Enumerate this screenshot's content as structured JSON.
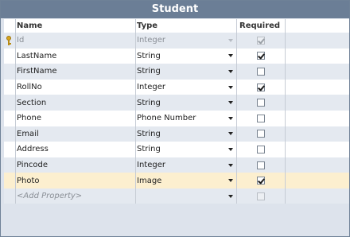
{
  "title": "Student",
  "columns": {
    "name": "Name",
    "type": "Type",
    "required": "Required"
  },
  "rows": [
    {
      "name": "Id",
      "type": "Integer",
      "required": true,
      "key": true,
      "disabled": true
    },
    {
      "name": "LastName",
      "type": "String",
      "required": true
    },
    {
      "name": "FirstName",
      "type": "String",
      "required": false
    },
    {
      "name": "RollNo",
      "type": "Integer",
      "required": true
    },
    {
      "name": "Section",
      "type": "String",
      "required": false
    },
    {
      "name": "Phone",
      "type": "Phone Number",
      "required": false
    },
    {
      "name": "Email",
      "type": "String",
      "required": false
    },
    {
      "name": "Address",
      "type": "String",
      "required": false
    },
    {
      "name": "Pincode",
      "type": "Integer",
      "required": false
    },
    {
      "name": "Photo",
      "type": "Image",
      "required": true,
      "selected": true
    }
  ],
  "add_property_placeholder": "<Add Property>",
  "colors": {
    "titlebar": "#6b7e96",
    "alt_row": "#e4e9f0",
    "selected_row": "#fcefcf",
    "key_icon": "#d9a51c"
  },
  "icons": {
    "key": "key-icon",
    "dropdown": "dropdown-arrow-icon",
    "checkbox": "checkbox-icon"
  }
}
